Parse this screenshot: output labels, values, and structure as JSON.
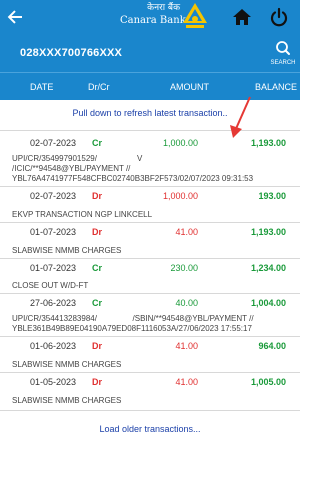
{
  "app": {
    "brand_hindi": "केनरा बैंक",
    "brand_name": "Canara Bank"
  },
  "account": {
    "number": "028XXX700766XXX",
    "search_label": "SEARCH"
  },
  "columns": {
    "date": "DATE",
    "drcr": "Dr/Cr",
    "amount": "AMOUNT",
    "balance": "BALANCE"
  },
  "pull_note": "Pull down to refresh latest transaction..",
  "transactions": [
    {
      "date": "02-07-2023",
      "type": "Cr",
      "amount": "1,000.00",
      "balance": "1,193.00",
      "description": "UPI/CR/354997901529/                  V\n/ICIC/**94548@YBL/PAYMENT //\nYBL76A4741977F548CFBC02740B3BF2F573/02/07/2023 09:31:53"
    },
    {
      "date": "02-07-2023",
      "type": "Dr",
      "amount": "1,000.00",
      "balance": "193.00",
      "description": "EKVP TRANSACTION NGP LINKCELL"
    },
    {
      "date": "01-07-2023",
      "type": "Dr",
      "amount": "41.00",
      "balance": "1,193.00",
      "description": "SLABWISE NMMB CHARGES"
    },
    {
      "date": "01-07-2023",
      "type": "Cr",
      "amount": "230.00",
      "balance": "1,234.00",
      "description": "CLOSE OUT W/D-FT"
    },
    {
      "date": "27-06-2023",
      "type": "Cr",
      "amount": "40.00",
      "balance": "1,004.00",
      "description": "UPI/CR/354413283984/                /SBIN/**94548@YBL/PAYMENT //\nYBLE361B49B89E04190A79ED08F1116053A/27/06/2023 17:55:17"
    },
    {
      "date": "01-06-2023",
      "type": "Dr",
      "amount": "41.00",
      "balance": "964.00",
      "description": "SLABWISE NMMB CHARGES"
    },
    {
      "date": "01-05-2023",
      "type": "Dr",
      "amount": "41.00",
      "balance": "1,005.00",
      "description": "SLABWISE NMMB CHARGES"
    }
  ],
  "load_older": "Load older transactions...",
  "colors": {
    "header_blue": "#1a86cc",
    "credit_green": "#1a9a3a",
    "debit_red": "#e03030",
    "link_blue": "#1a3fa8",
    "annotation_arrow": "#e53935"
  },
  "icons": {
    "back": "arrow-back-icon",
    "logo": "canara-bank-logo",
    "home": "home-icon",
    "power": "power-icon",
    "search": "search-icon"
  }
}
